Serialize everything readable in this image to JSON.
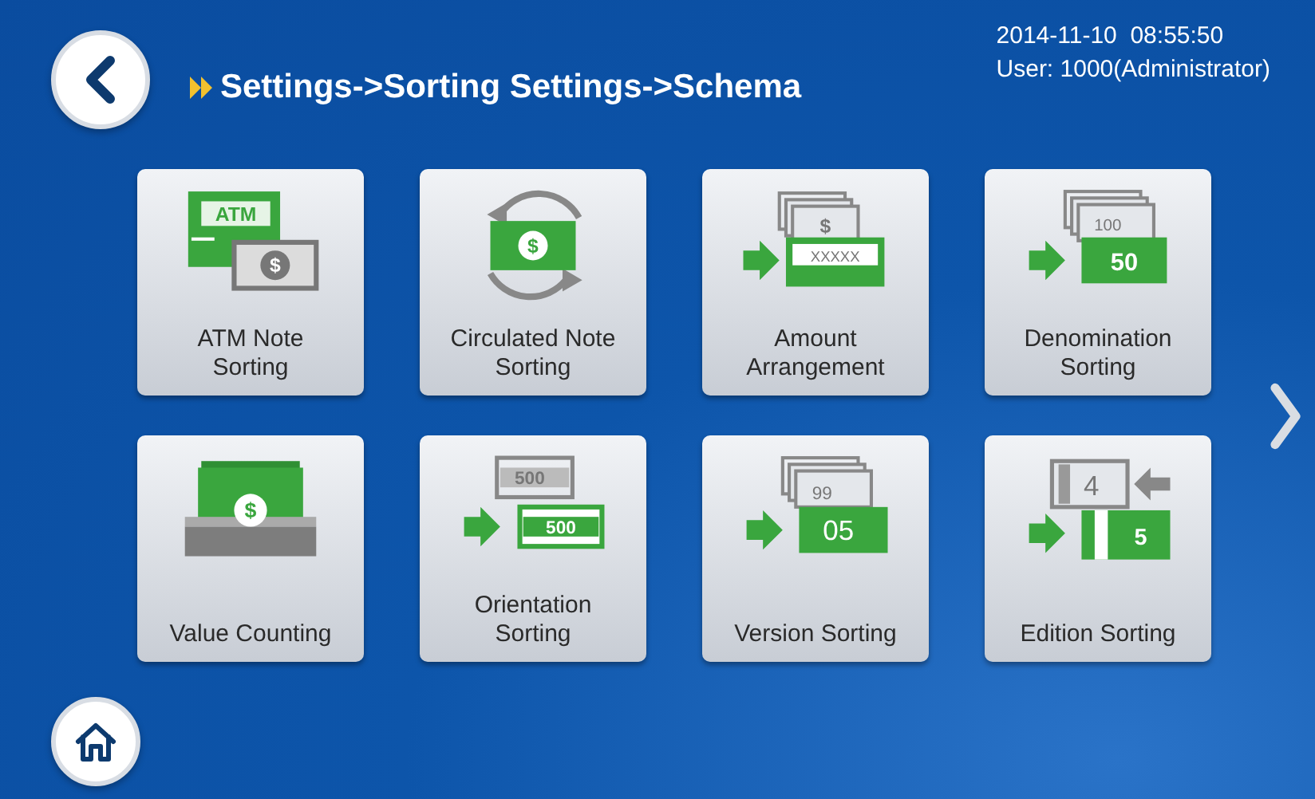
{
  "header": {
    "breadcrumb": "Settings->Sorting Settings->Schema",
    "datetime": "2014-11-10  08:55:50",
    "user": "User: 1000(Administrator)"
  },
  "tiles": [
    {
      "label": "ATM Note\nSorting",
      "kind": "atm",
      "icon_texts": [
        "ATM",
        "$"
      ]
    },
    {
      "label": "Circulated Note\nSorting",
      "kind": "circulated",
      "icon_texts": [
        "$"
      ]
    },
    {
      "label": "Amount\nArrangement",
      "kind": "amount",
      "icon_texts": [
        "$",
        "XXXXX"
      ]
    },
    {
      "label": "Denomination\nSorting",
      "kind": "denomination",
      "icon_texts": [
        "100",
        "50"
      ]
    },
    {
      "label": "Value Counting",
      "kind": "value",
      "icon_texts": [
        "$"
      ]
    },
    {
      "label": "Orientation\nSorting",
      "kind": "orientation",
      "icon_texts": [
        "500",
        "500"
      ]
    },
    {
      "label": "Version Sorting",
      "kind": "version",
      "icon_texts": [
        "99",
        "05"
      ]
    },
    {
      "label": "Edition Sorting",
      "kind": "edition",
      "icon_texts": [
        "4",
        "5"
      ]
    }
  ]
}
